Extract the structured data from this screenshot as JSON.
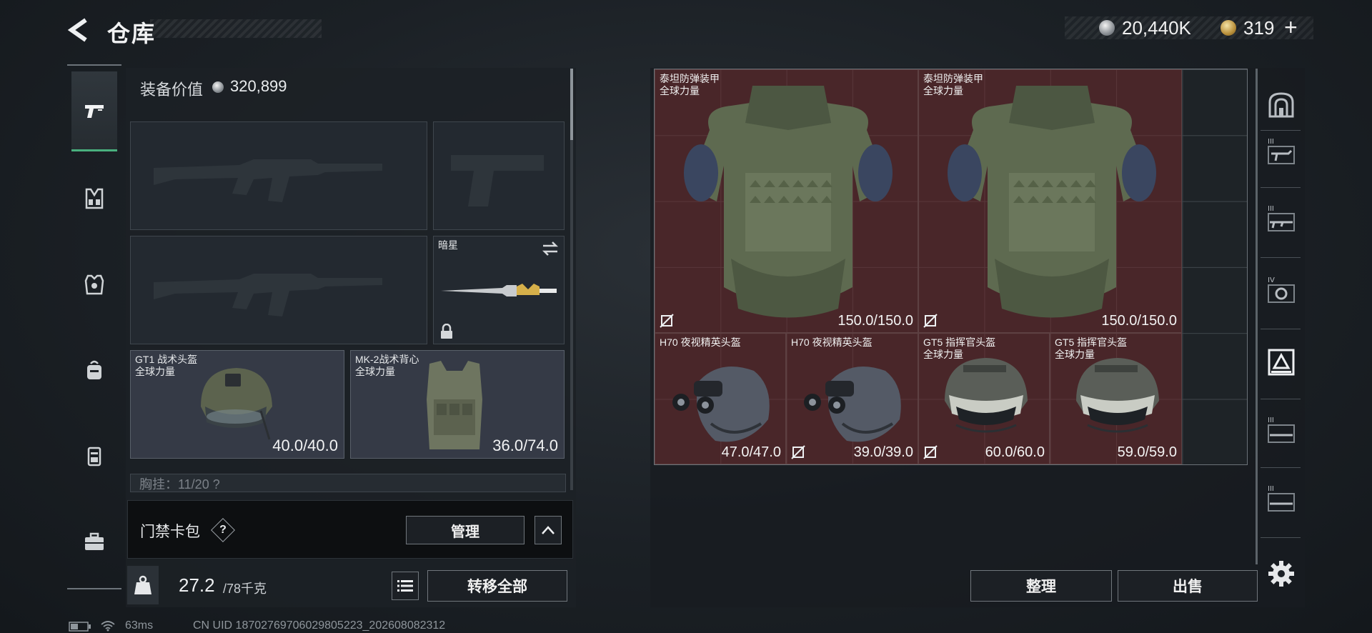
{
  "header": {
    "title": "仓库",
    "money": "20,440K",
    "gold": "319",
    "gold_plus": "+"
  },
  "rail": {
    "items": [
      {
        "name": "weapons",
        "icon": "pistol-icon",
        "active": true
      },
      {
        "name": "chest-rig",
        "icon": "chest-rig-icon",
        "active": false
      },
      {
        "name": "armor",
        "icon": "armor-vest-icon",
        "active": false
      },
      {
        "name": "backpack",
        "icon": "backpack-icon",
        "active": false
      },
      {
        "name": "pouch",
        "icon": "pouch-icon",
        "active": false
      },
      {
        "name": "case",
        "icon": "case-icon",
        "active": false
      }
    ]
  },
  "loadout": {
    "value_label": "装备价值",
    "value": "320,899",
    "melee": {
      "name": "暗星",
      "swap_icon": "swap-icon",
      "lock_icon": "lock-icon"
    },
    "helmet": {
      "name": "GT1 战术头盔",
      "sub": "全球力量",
      "durability": "40.0/40.0"
    },
    "vest": {
      "name": "MK-2战术背心",
      "sub": "全球力量",
      "durability": "36.0/74.0"
    },
    "belt_label": "胸挂：11/20 ?",
    "keycard_label": "门禁卡包",
    "keycard_help": "?",
    "manage_label": "管理",
    "weight_value": "27.2",
    "weight_unit": "/78千克",
    "transfer_label": "转移全部"
  },
  "stash": {
    "items": [
      {
        "name": "泰坦防弹装甲",
        "sub": "全球力量",
        "durability": "150.0/150.0",
        "nolock": true
      },
      {
        "name": "泰坦防弹装甲",
        "sub": "全球力量",
        "durability": "150.0/150.0",
        "nolock": true
      },
      {
        "name": "H70 夜视精英头盔",
        "sub": "",
        "durability": "47.0/47.0",
        "nolock": false
      },
      {
        "name": "H70 夜视精英头盔",
        "sub": "",
        "durability": "39.0/39.0",
        "nolock": true
      },
      {
        "name": "GT5 指挥官头盔",
        "sub": "全球力量",
        "durability": "60.0/60.0",
        "nolock": true
      },
      {
        "name": "GT5 指挥官头盔",
        "sub": "全球力量",
        "durability": "59.0/59.0",
        "nolock": false
      }
    ],
    "sort_label": "整理",
    "sell_label": "出售",
    "right_tabs": [
      {
        "icon": "safe-box-icon",
        "tier": ""
      },
      {
        "icon": "weapon-rack-icon",
        "tier": "III"
      },
      {
        "icon": "rifle-rack-icon",
        "tier": "III"
      },
      {
        "icon": "tool-rack-icon",
        "tier": "IV"
      },
      {
        "icon": "armor-rack-icon",
        "tier": ""
      },
      {
        "icon": "shelf-icon",
        "tier": "III"
      },
      {
        "icon": "shelf-icon",
        "tier": "III"
      }
    ]
  },
  "status": {
    "ping": "63ms",
    "uid": "CN UID 18702769706029805223_202608082312"
  },
  "colors": {
    "accent_green": "#49b07e",
    "item_bg": "#6e2a2c",
    "panel_bg": "#1c2126"
  }
}
